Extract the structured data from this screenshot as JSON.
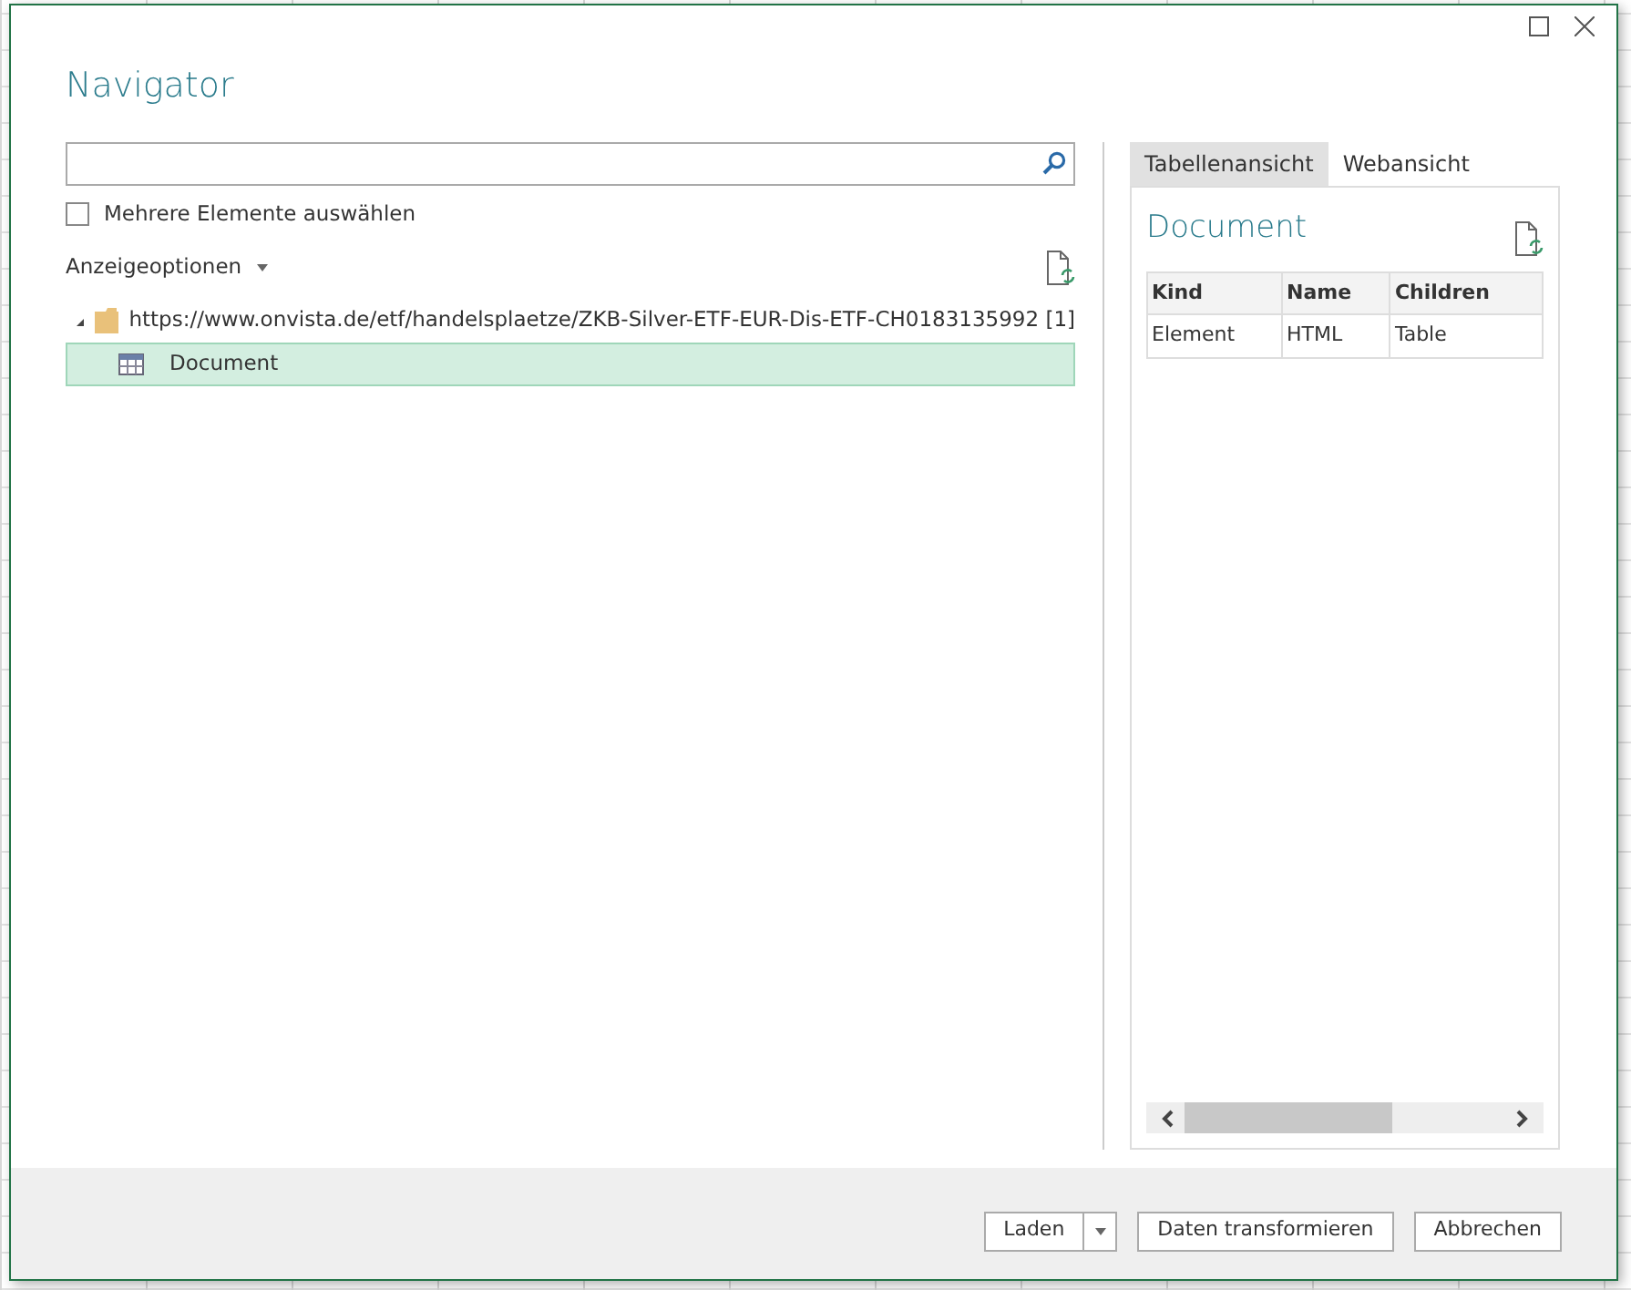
{
  "window": {
    "title": "Navigator"
  },
  "multi_select": {
    "label": "Mehrere Elemente auswählen",
    "checked": false
  },
  "display_options": {
    "label": "Anzeigeoptionen"
  },
  "tree": [
    {
      "label": "https://www.onvista.de/etf/handelsplaetze/ZKB-Silver-ETF-EUR-Dis-ETF-CH0183135992 [1]",
      "expanded": true,
      "selected": false,
      "children": [
        {
          "label": "Document",
          "selected": true
        }
      ]
    }
  ],
  "tabs": [
    {
      "label": "Tabellenansicht",
      "selected": true
    },
    {
      "label": "Webansicht",
      "selected": false
    }
  ],
  "preview": {
    "title": "Document",
    "table": {
      "columns": [
        "Kind",
        "Name",
        "Children"
      ],
      "rows": [
        [
          "Element",
          "HTML",
          "Table"
        ]
      ]
    }
  },
  "buttons": [
    {
      "label": "Laden",
      "kind": "split"
    },
    {
      "label": "Daten transformieren",
      "kind": "plain"
    },
    {
      "label": "Abbrechen",
      "kind": "plain"
    }
  ]
}
